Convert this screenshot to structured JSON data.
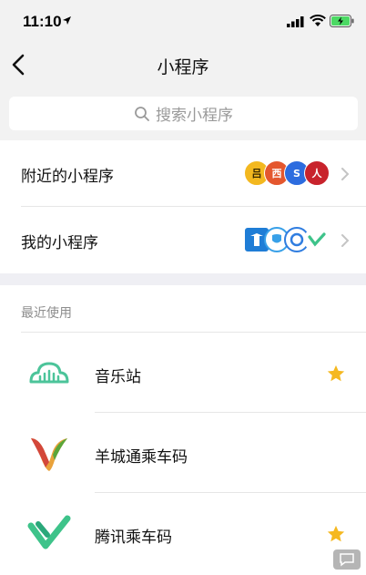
{
  "status_bar": {
    "time": "11:10"
  },
  "nav": {
    "title": "小程序"
  },
  "search": {
    "placeholder": "搜索小程序"
  },
  "menu": [
    {
      "label": "附近的小程序"
    },
    {
      "label": "我的小程序"
    }
  ],
  "nearby_avatars": [
    "吕",
    "西",
    "S",
    "人"
  ],
  "recent": {
    "title": "最近使用",
    "apps": [
      {
        "name": "音乐站",
        "starred": true
      },
      {
        "name": "羊城通乘车码",
        "starred": false
      },
      {
        "name": "腾讯乘车码",
        "starred": true
      }
    ]
  },
  "colors": {
    "star": "#f5b820",
    "music_green": "#4cc49a"
  }
}
